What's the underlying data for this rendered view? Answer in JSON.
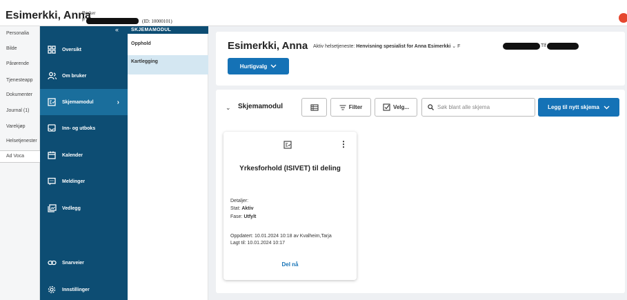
{
  "header": {
    "patient_name": "Esimerkki, Anna",
    "role": "Bruker",
    "id_prefix": "F",
    "id_text": "(ID: 10000101)",
    "avatar_icon": "user-avatar-icon"
  },
  "left_tabs": [
    {
      "label": "Personalia"
    },
    {
      "label": "Bilde"
    },
    {
      "label": "Pårørende"
    },
    {
      "label": "Tjenesteapp"
    },
    {
      "label": "Dokumenter"
    },
    {
      "label": "Journal (1)"
    },
    {
      "label": "Varekjøp"
    },
    {
      "label": "Helsetjenester"
    },
    {
      "label": "Ad Voca"
    }
  ],
  "sidebar": {
    "collapse_glyph": "«",
    "items": [
      {
        "label": "Oversikt",
        "icon": "grid-icon"
      },
      {
        "label": "Om bruker",
        "icon": "users-icon"
      },
      {
        "label": "Skjemamodul",
        "icon": "form-icon",
        "active": true
      },
      {
        "label": "Inn- og utboks",
        "icon": "inbox-icon"
      },
      {
        "label": "Kalender",
        "icon": "calendar-icon"
      },
      {
        "label": "Meldinger",
        "icon": "message-icon"
      },
      {
        "label": "Vedlegg",
        "icon": "attachment-icon"
      },
      {
        "label": "Snarveier",
        "icon": "link-icon"
      },
      {
        "label": "Innstillinger",
        "icon": "settings-icon"
      }
    ]
  },
  "submenu": {
    "title": "SKJEMAMODUL",
    "items": [
      {
        "label": "Opphold"
      },
      {
        "label": "Kartlegging",
        "active": true
      }
    ]
  },
  "main": {
    "name": "Esimerkki, Anna",
    "helse_label": "Aktiv helsetjeneste:",
    "helse_value": "Henvisning spesialist for Anna Esimerkki",
    "f_label": "F",
    "tlf_label": "Tlf",
    "hurtigvalg": "Hurtigvalg"
  },
  "skjemamodul": {
    "title": "Skjemamodul",
    "filter_label": "Filter",
    "velg_label": "Velg...",
    "search_placeholder": "Søk blant alle skjema",
    "add_button": "Legg til nytt skjema"
  },
  "card": {
    "title": "Yrkesforhold (ISIVET) til deling",
    "detaljer": "Detaljer:",
    "stat_label": "Stat:",
    "stat_value": "Aktiv",
    "fase_label": "Fase:",
    "fase_value": "Utfylt",
    "oppdatert": "Oppdatert: 10.01.2024 10:18 av Kvalheim,Tarja",
    "lagt_til": "Lagt til: 10.01.2024 10:17",
    "action": "Del nå"
  },
  "colors": {
    "sidebar_bg": "#0d4d73",
    "sidebar_active": "#1a6e9c",
    "primary_button": "#1572b6",
    "submenu_active": "#d4e7f2"
  }
}
